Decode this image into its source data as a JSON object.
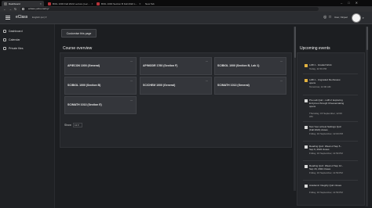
{
  "browser": {
    "tabs": [
      {
        "label": "Dashboard",
        "active": true
      },
      {
        "label": "BIOL 1000 Fall 2022 Lecture (Lec..."
      },
      {
        "label": "BIOL 1000 Section B Fall 2022 L..."
      },
      {
        "label": "New Tab"
      }
    ],
    "window_controls": [
      "–",
      "□",
      "✕"
    ],
    "url": "eclass.yorku.ca/my/",
    "nav_icons": {
      "back": "back-arrow-icon",
      "forward": "forward-arrow-icon",
      "reload": "reload-icon"
    }
  },
  "header": {
    "brand": "eClass",
    "language": "English (en) ▾",
    "user_name": "User, Kinjeel",
    "user_menu_caret": "▾",
    "icons": {
      "menu": "hamburger-icon",
      "notifications": "bell-icon",
      "messages": "chat-icon",
      "avatar": "avatar"
    }
  },
  "sidebar": {
    "items": [
      {
        "label": "Dashboard",
        "icon": "dashboard-icon"
      },
      {
        "label": "Calendar",
        "icon": "calendar-icon"
      },
      {
        "label": "Private files",
        "icon": "file-icon"
      }
    ]
  },
  "main": {
    "customise_label": "Customise this page",
    "course_overview_title": "Course overview",
    "courses": [
      {
        "name": "AP/ECON 1000 (General)",
        "menu": "..."
      },
      {
        "name": "AP/MODR 1760 (Section F)",
        "menu": "..."
      },
      {
        "name": "SC/BIOL 1000 (Section B, Lab 1)",
        "menu": "..."
      },
      {
        "name": "SC/BIOL 1000 (Section B)",
        "menu": "..."
      },
      {
        "name": "SC/CHEM 1000 (General)",
        "menu": "..."
      },
      {
        "name": "SC/MATH 1013 (General)",
        "menu": "..."
      },
      {
        "name": "SC/MATH 1013 (Section E)",
        "menu": "..."
      }
    ],
    "show_label": "Show",
    "show_value": "12 ▾"
  },
  "upcoming": {
    "title": "Upcoming events",
    "events": [
      {
        "name": "LAB 1 - Graded Work",
        "date": "Today, 11:59 PM",
        "icon": "calendar-icon"
      },
      {
        "name": "LAB 1 - Ungraded Re-Review opens",
        "date": "Tomorrow, 12:00 AM",
        "icon": "calendar-icon"
      },
      {
        "name": "Pre-Lab Quiz - LAB 2: Exploring Enzymes through Cheesemaking opens",
        "date": "Thursday, 15 September, 12:00 AM",
        "icon": "quiz-icon"
      },
      {
        "name": "Test Your at best Settings Quiz (Fall 2022) closes",
        "date": "Friday, 16 September, 12:00 PM",
        "icon": "quiz-icon"
      },
      {
        "name": "Reading Quiz: Week of Sep 5 - Sep 9, 2022 closes",
        "date": "Friday, 16 September, 11:59 PM",
        "icon": "quiz-icon"
      },
      {
        "name": "Reading Quiz: Week of Sep 12 - Sep 16, 2022 closes",
        "date": "Friday, 16 September, 11:59 PM",
        "icon": "quiz-icon"
      },
      {
        "name": "Academic Integrity Quiz closes",
        "date": "Friday, 16 September, 11:59 PM",
        "icon": "quiz-icon"
      }
    ]
  }
}
